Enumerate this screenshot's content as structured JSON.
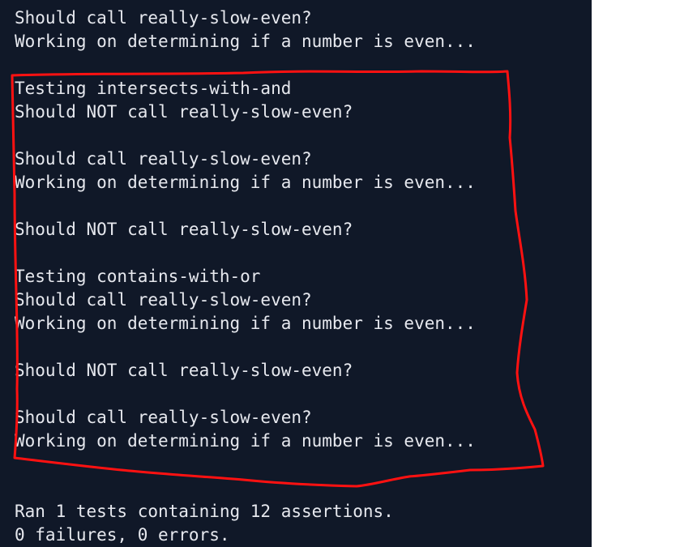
{
  "terminal": {
    "lines": [
      "Should call really-slow-even?",
      "Working on determining if a number is even...",
      "",
      "Testing intersects-with-and",
      "Should NOT call really-slow-even?",
      "",
      "Should call really-slow-even?",
      "Working on determining if a number is even...",
      "",
      "Should NOT call really-slow-even?",
      "",
      "Testing contains-with-or",
      "Should call really-slow-even?",
      "Working on determining if a number is even...",
      "",
      "Should NOT call really-slow-even?",
      "",
      "Should call really-slow-even?",
      "Working on determining if a number is even...",
      "",
      "",
      "Ran 1 tests containing 12 assertions.",
      "0 failures, 0 errors."
    ]
  },
  "annotation": {
    "color": "#ff1111"
  },
  "colors": {
    "terminal_background": "#101828",
    "terminal_text": "#e6e8ee",
    "page_background": "#ffffff"
  }
}
